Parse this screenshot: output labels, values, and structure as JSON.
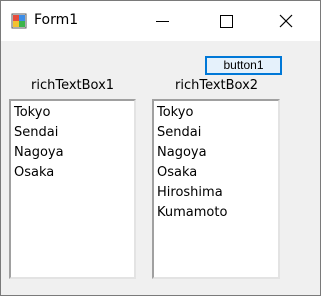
{
  "window": {
    "title": "Form1",
    "icon": "winforms-app-icon",
    "controls": {
      "minimize": "minimize-icon",
      "maximize": "maximize-icon",
      "close": "close-icon"
    }
  },
  "button1": {
    "label": "button1"
  },
  "richTextBox1": {
    "label": "richTextBox1",
    "lines": [
      "Tokyo",
      "Sendai",
      "Nagoya",
      "Osaka"
    ]
  },
  "richTextBox2": {
    "label": "richTextBox2",
    "lines": [
      "Tokyo",
      "Sendai",
      "Nagoya",
      "Osaka",
      "Hiroshima",
      "Kumamoto"
    ]
  },
  "colors": {
    "window_bg": "#f0f0f0",
    "titlebar_bg": "#ffffff",
    "button_focus_border": "#0078d7",
    "button_bg": "#e5f1fb"
  }
}
